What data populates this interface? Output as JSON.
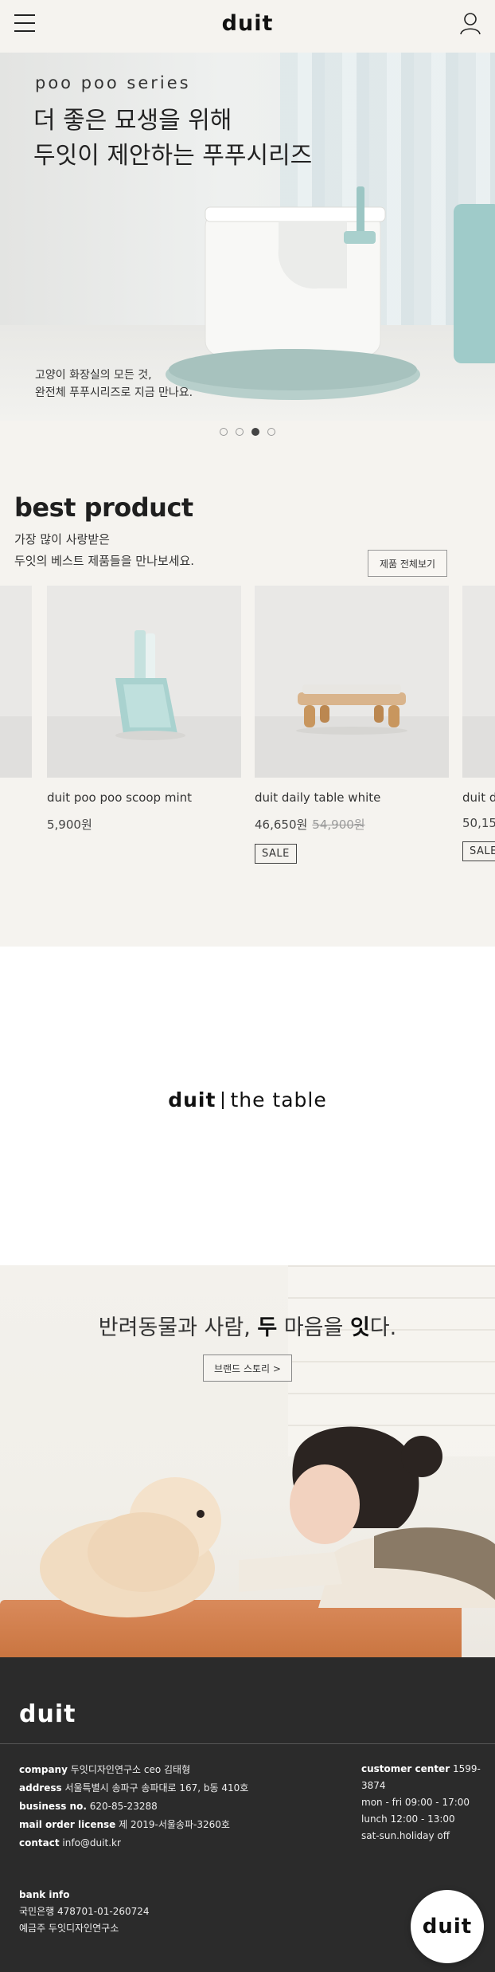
{
  "header": {
    "logo": "duit",
    "menu_icon": "hamburger-menu-icon",
    "user_icon": "user-icon"
  },
  "hero": {
    "series": "poo poo series",
    "title_lines": [
      "더 좋은 묘생을 위해",
      "두잇이 제안하는 푸푸시리즈"
    ],
    "caption_lines": [
      "고양이 화장실의 모든 것,",
      "완전체 푸푸시리즈로 지금 만나요."
    ],
    "slide_count": 4,
    "active_slide": 3
  },
  "best": {
    "title": "best product",
    "desc_lines": [
      "가장 많이 사랑받은",
      "두잇의 베스트 제품들을 만나보세요."
    ],
    "view_all": "제품 전체보기",
    "products": [
      {
        "name": "duit poo poo scoop mint",
        "price": "5,900원",
        "original": "",
        "badge": ""
      },
      {
        "name": "duit daily table white",
        "price": "46,650원",
        "original": "54,900원",
        "badge": "SALE"
      },
      {
        "name": "duit d",
        "price": "50,15",
        "original": "",
        "badge": "SALE"
      }
    ]
  },
  "table_banner": {
    "brand": "duit",
    "sub": "the table"
  },
  "brand_section": {
    "title_parts": [
      "반려동물과 사람, ",
      "두",
      " 마음을 ",
      "잇",
      "다."
    ],
    "button": "브랜드 스토리 >"
  },
  "footer": {
    "logo": "duit",
    "company_label": "company",
    "company": "두잇디자인연구소 ceo 김태형",
    "address_label": "address",
    "address": "서울특별시 송파구 송파대로 167, b동 410호",
    "business_label": "business no.",
    "business": "620-85-23288",
    "mail_label": "mail order license",
    "mail": "제 2019-서울송파-3260호",
    "contact_label": "contact",
    "contact": "info@duit.kr",
    "cs_label": "customer center",
    "cs_phone_1": "1599-",
    "cs_phone_2": "3874",
    "cs_hours": "mon - fri 09:00 - 17:00",
    "cs_lunch": "lunch 12:00 - 13:00",
    "cs_off": "sat-sun.holiday off",
    "bank_label": "bank info",
    "bank_account": "국민은행 478701-01-260724",
    "bank_holder": "예금주 두잇디자인연구소",
    "badge": "duit"
  }
}
